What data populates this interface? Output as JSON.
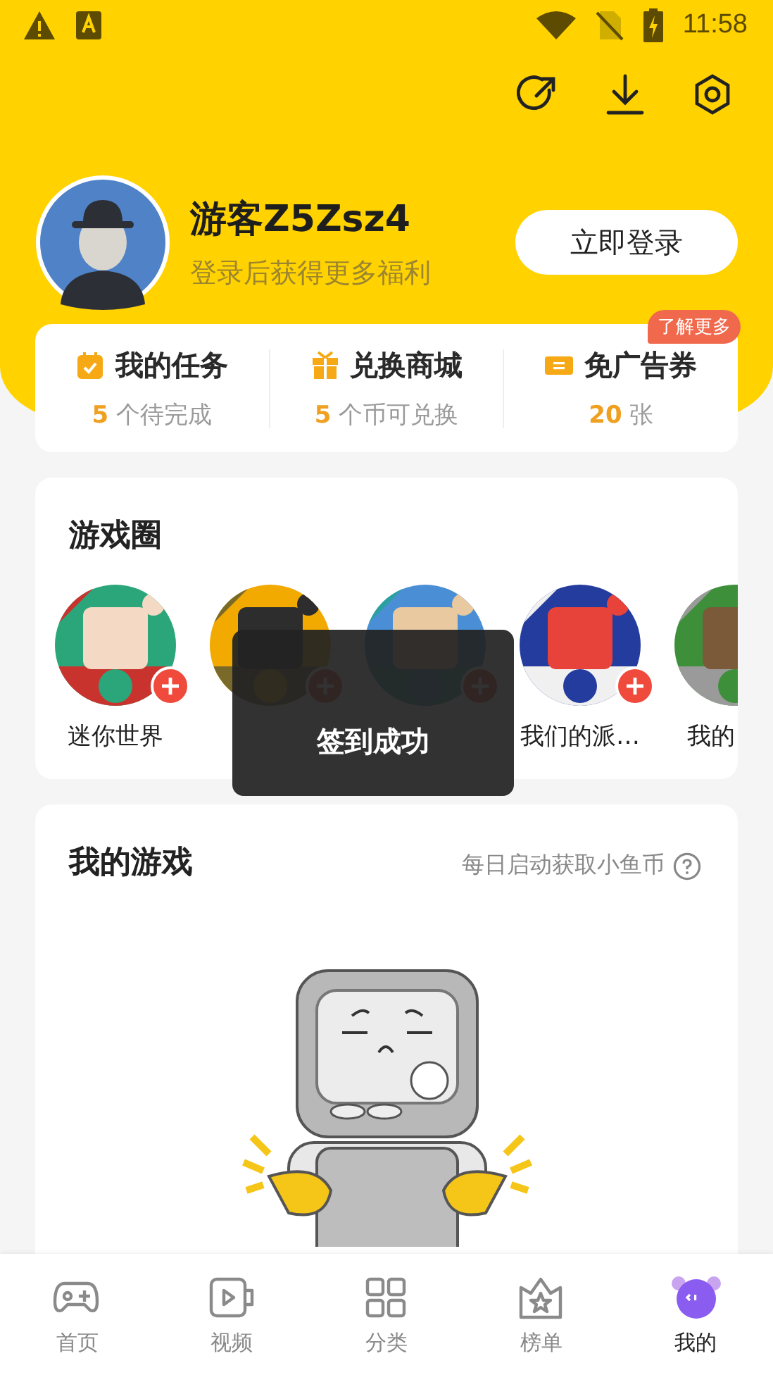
{
  "status_bar": {
    "time": "11:58"
  },
  "profile": {
    "name": "游客Z5Zsz4",
    "subtitle": "登录后获得更多福利",
    "login_button": "立即登录"
  },
  "stats": [
    {
      "kind": "task",
      "title": "我的任务",
      "count": "5",
      "unit": "个待完成"
    },
    {
      "kind": "gift",
      "title": "兑换商城",
      "count": "5",
      "unit": "个币可兑换"
    },
    {
      "kind": "ticket",
      "title": "免广告券",
      "count": "20",
      "unit": "张",
      "badge": "了解更多"
    }
  ],
  "game_circle": {
    "title": "游戏圈",
    "games": [
      {
        "name": "迷你世界",
        "joinable": true
      },
      {
        "joinable": true
      },
      {
        "joinable": true
      },
      {
        "name": "我们的派…",
        "joinable": true
      },
      {
        "name": "我的",
        "joinable": false
      }
    ]
  },
  "my_games": {
    "title": "我的游戏",
    "hint": "每日启动获取小鱼币"
  },
  "toast": "签到成功",
  "nav": [
    {
      "kind": "gamepad",
      "label": "首页",
      "selected": false
    },
    {
      "kind": "video",
      "label": "视频",
      "selected": false
    },
    {
      "kind": "grid",
      "label": "分类",
      "selected": false
    },
    {
      "kind": "crown",
      "label": "榜单",
      "selected": false
    },
    {
      "kind": "mascot",
      "label": "我的",
      "selected": true
    }
  ]
}
